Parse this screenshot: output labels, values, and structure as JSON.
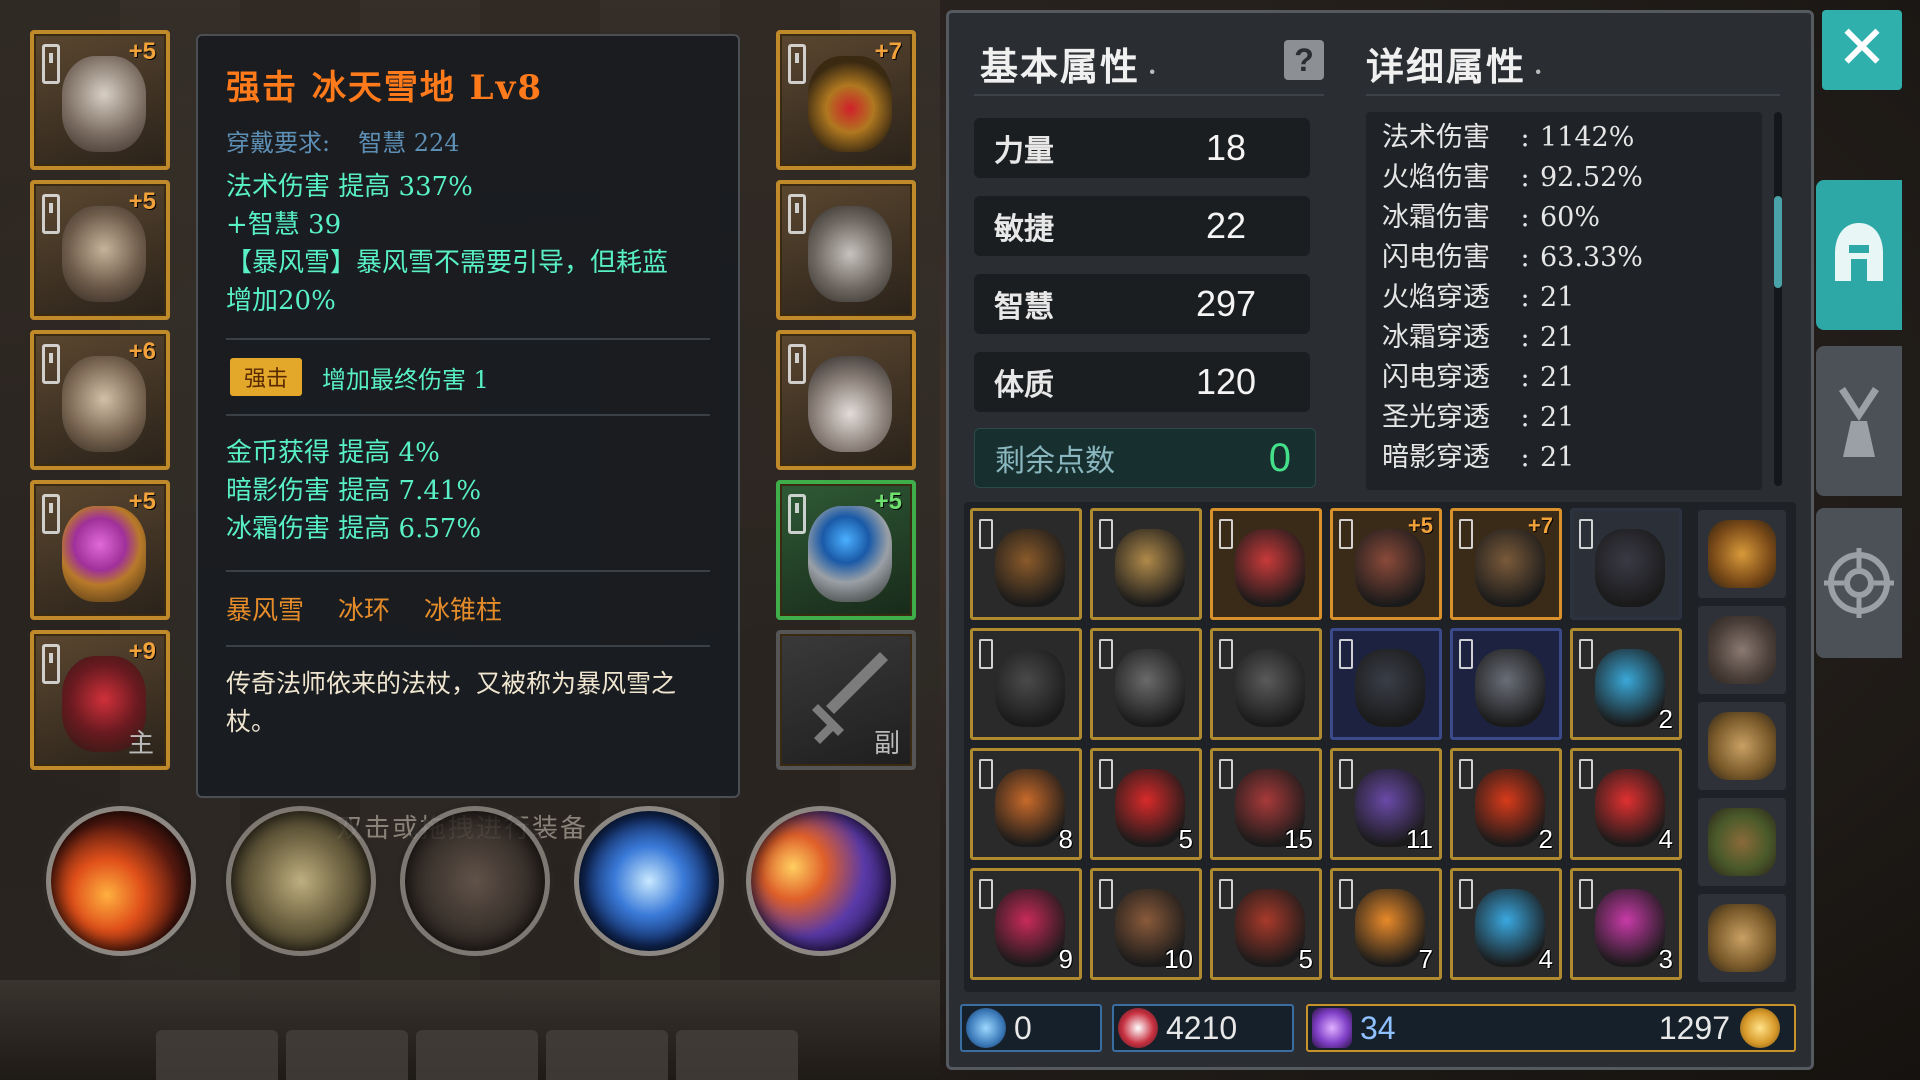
{
  "tooltip": {
    "title": "强击 冰天雪地 Lv8",
    "req_label": "穿戴要求:",
    "req_value": "智慧 224",
    "lines": [
      "法术伤害 提高 337%",
      "+智慧 39",
      "【暴风雪】暴风雪不需要引导，但耗蓝",
      "增加20%"
    ],
    "badge": "强击",
    "badge_text": "增加最终伤害 1",
    "bonus": [
      "金币获得 提高 4%",
      "暗影伤害 提高 7.41%",
      "冰霜伤害 提高 6.57%"
    ],
    "skills": [
      "暴风雪",
      "冰环",
      "冰锥柱"
    ],
    "desc": "传奇法师依来的法杖，又被称为暴风雪之杖。"
  },
  "hint": "双击或拖拽进行装备",
  "left_slots": [
    {
      "name": "helmet",
      "plus": "+5"
    },
    {
      "name": "armor",
      "plus": "+5"
    },
    {
      "name": "cloak",
      "plus": "+6"
    },
    {
      "name": "ring",
      "plus": "+5"
    },
    {
      "name": "main-weapon",
      "plus": "+9",
      "tag": "主"
    }
  ],
  "right_slots": [
    {
      "name": "necklace",
      "plus": "+7"
    },
    {
      "name": "gloves",
      "plus": ""
    },
    {
      "name": "boots",
      "plus": ""
    },
    {
      "name": "ring-2",
      "plus": "+5"
    },
    {
      "name": "off-weapon",
      "plus": "",
      "tag": "副"
    }
  ],
  "basic": {
    "header": "基本属性",
    "stats": [
      {
        "label": "力量",
        "value": "18"
      },
      {
        "label": "敏捷",
        "value": "22"
      },
      {
        "label": "智慧",
        "value": "297"
      },
      {
        "label": "体质",
        "value": "120"
      }
    ],
    "remain_label": "剩余点数",
    "remain_value": "0"
  },
  "detail": {
    "header": "详细属性",
    "rows": [
      {
        "k": "法术伤害",
        "v": "1142%"
      },
      {
        "k": "火焰伤害",
        "v": "92.52%"
      },
      {
        "k": "冰霜伤害",
        "v": "60%"
      },
      {
        "k": "闪电伤害",
        "v": "63.33%"
      },
      {
        "k": "火焰穿透",
        "v": "21"
      },
      {
        "k": "冰霜穿透",
        "v": "21"
      },
      {
        "k": "闪电穿透",
        "v": "21"
      },
      {
        "k": "圣光穿透",
        "v": "21"
      },
      {
        "k": "暗影穿透",
        "v": "21"
      }
    ]
  },
  "inventory": [
    [
      {
        "n": "pouch",
        "c": ""
      },
      {
        "n": "backpack",
        "c": ""
      },
      {
        "n": "staff-red",
        "c": "",
        "st": "orange"
      },
      {
        "n": "staff-twisted",
        "c": "",
        "p": "+5",
        "st": "orange"
      },
      {
        "n": "mace",
        "c": "",
        "p": "+7",
        "st": "orange"
      },
      {
        "n": "dark-boots",
        "c": "",
        "st": "dark"
      }
    ],
    [
      {
        "n": "greatsword",
        "c": ""
      },
      {
        "n": "spear",
        "c": ""
      },
      {
        "n": "iron-helm",
        "c": ""
      },
      {
        "n": "scythe",
        "c": "",
        "st": "blue"
      },
      {
        "n": "halberd",
        "c": "",
        "st": "blue"
      },
      {
        "n": "blue-scroll",
        "c": "2"
      }
    ],
    [
      {
        "n": "winged-helm",
        "c": "8"
      },
      {
        "n": "red-crystal",
        "c": "5"
      },
      {
        "n": "red-ore",
        "c": "15"
      },
      {
        "n": "purple-ore",
        "c": "11"
      },
      {
        "n": "red-orb",
        "c": "2"
      },
      {
        "n": "red-gem",
        "c": "4"
      }
    ],
    [
      {
        "n": "pink-ore",
        "c": "9"
      },
      {
        "n": "wood",
        "c": "10"
      },
      {
        "n": "red-feather",
        "c": "5"
      },
      {
        "n": "amber",
        "c": "7"
      },
      {
        "n": "blue-crystal",
        "c": "4"
      },
      {
        "n": "magenta-ore",
        "c": "3"
      }
    ]
  ],
  "currency": {
    "runes": "0",
    "trophies": "4210",
    "gems": "34",
    "gold": "1297"
  },
  "colors": {
    "accent": "#2fb0ac",
    "gold_border": "#c08a2a",
    "title_orange": "#ff7a1a",
    "stat_green": "#58f0c4"
  }
}
